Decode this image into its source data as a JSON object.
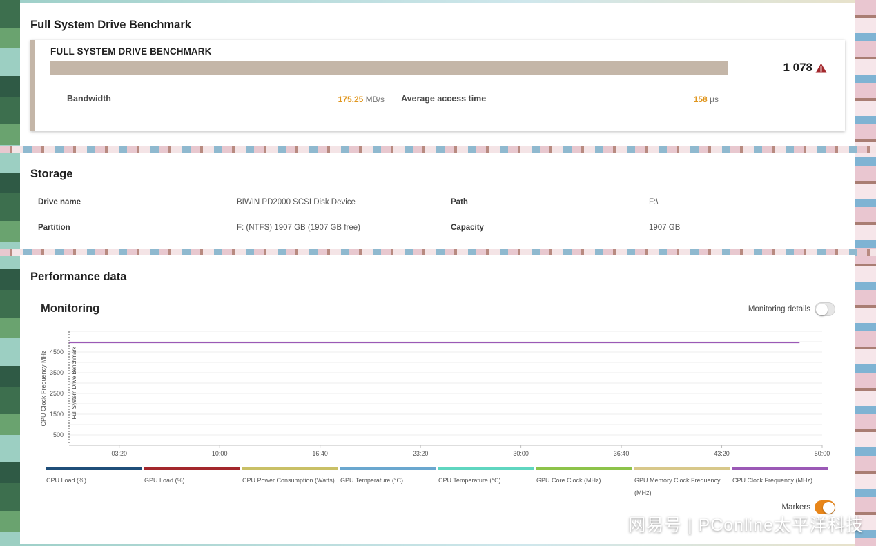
{
  "benchmark": {
    "section_title": "Full System Drive Benchmark",
    "name": "FULL SYSTEM DRIVE BENCHMARK",
    "score": "1 078",
    "score_fill_fraction": 1.0,
    "bandwidth_label": "Bandwidth",
    "bandwidth_value": "175.25",
    "bandwidth_unit": "MB/s",
    "access_label": "Average access time",
    "access_value": "158",
    "access_unit": "µs",
    "warning_icon": "warning-triangle-icon",
    "accent_color": "#c4b6a8",
    "value_color": "#e0961e",
    "warning_color": "#a3272c"
  },
  "storage": {
    "section_title": "Storage",
    "drive_name_label": "Drive name",
    "drive_name_value": "BIWIN PD2000 SCSI Disk Device",
    "path_label": "Path",
    "path_value": "F:\\",
    "partition_label": "Partition",
    "partition_value": "F: (NTFS) 1907 GB (1907 GB free)",
    "capacity_label": "Capacity",
    "capacity_value": "1907 GB"
  },
  "performance": {
    "section_title": "Performance data",
    "monitoring_title": "Monitoring",
    "monitoring_details_label": "Monitoring details",
    "monitoring_details_on": false,
    "markers_label": "Markers",
    "markers_on": true
  },
  "chart_data": {
    "type": "line",
    "ylabel": "CPU Clock Frequency MHz",
    "y_ticks": [
      500,
      1500,
      2500,
      3500,
      4500
    ],
    "ylim": [
      0,
      5500
    ],
    "x_ticks": [
      "03:20",
      "10:00",
      "16:40",
      "23:20",
      "30:00",
      "36:40",
      "43:20",
      "50:00"
    ],
    "x_tick_seconds": [
      200,
      600,
      1000,
      1400,
      1800,
      2200,
      2600,
      3000
    ],
    "xlim_seconds": [
      0,
      3000
    ],
    "marker_label": "Full System Drive Benchmark",
    "grid": true,
    "series": [
      {
        "name": "CPU Clock Frequency (MHz)",
        "color": "#9b59b6",
        "x_seconds": [
          0,
          2910
        ],
        "values": [
          4950,
          4950
        ]
      }
    ],
    "legend": [
      {
        "label": "CPU Load (%)",
        "color": "#1f4e79"
      },
      {
        "label": "GPU Load (%)",
        "color": "#a3272c"
      },
      {
        "label": "CPU Power Consumption (Watts)",
        "color": "#c9c066"
      },
      {
        "label": "GPU Temperature (°C)",
        "color": "#6aa7cf"
      },
      {
        "label": "CPU Temperature (°C)",
        "color": "#5fd6c0"
      },
      {
        "label": "GPU Core Clock (MHz)",
        "color": "#8dc34a"
      },
      {
        "label": "GPU Memory Clock Frequency (MHz)",
        "color": "#d8c88a"
      },
      {
        "label": "CPU Clock Frequency (MHz)",
        "color": "#9b59b6"
      }
    ]
  },
  "watermark": "网易号 | PConline太平洋科技"
}
